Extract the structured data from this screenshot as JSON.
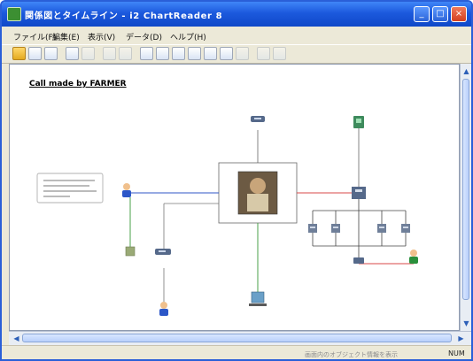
{
  "window": {
    "title": "関係図とタイムライン - i2 ChartReader 8",
    "controls": [
      "minimize-icon",
      "maximize-icon",
      "close-icon"
    ]
  },
  "menu": {
    "items": [
      "ファイル(F)",
      "編集(E)",
      "表示(V)",
      "データ(D)",
      "ヘルプ(H)"
    ]
  },
  "toolbar": {
    "icons": [
      "open-folder-icon",
      "open-file-icon",
      "copy-icon",
      "chart-icon",
      "link-icon",
      "select-icon",
      "move-icon",
      "cut-icon",
      "paste-icon",
      "zoom-in-icon",
      "zoom-out-icon",
      "fit-icon",
      "grid-icon",
      "print-icon",
      "back-arrow-icon",
      "forward-arrow-icon"
    ]
  },
  "chart": {
    "title": "Call made by FARMER"
  },
  "statusbar": {
    "message": "画面内のオブジェクト情報を表示",
    "num": "NUM"
  },
  "colors": {
    "titlebar": "#1c59dd",
    "menubar": "#ece9d8",
    "canvas": "#ffffff",
    "link_blue": "#2f55c7",
    "link_red": "#d94a4a",
    "link_green": "#4aa14a",
    "link_gray": "#666666"
  }
}
